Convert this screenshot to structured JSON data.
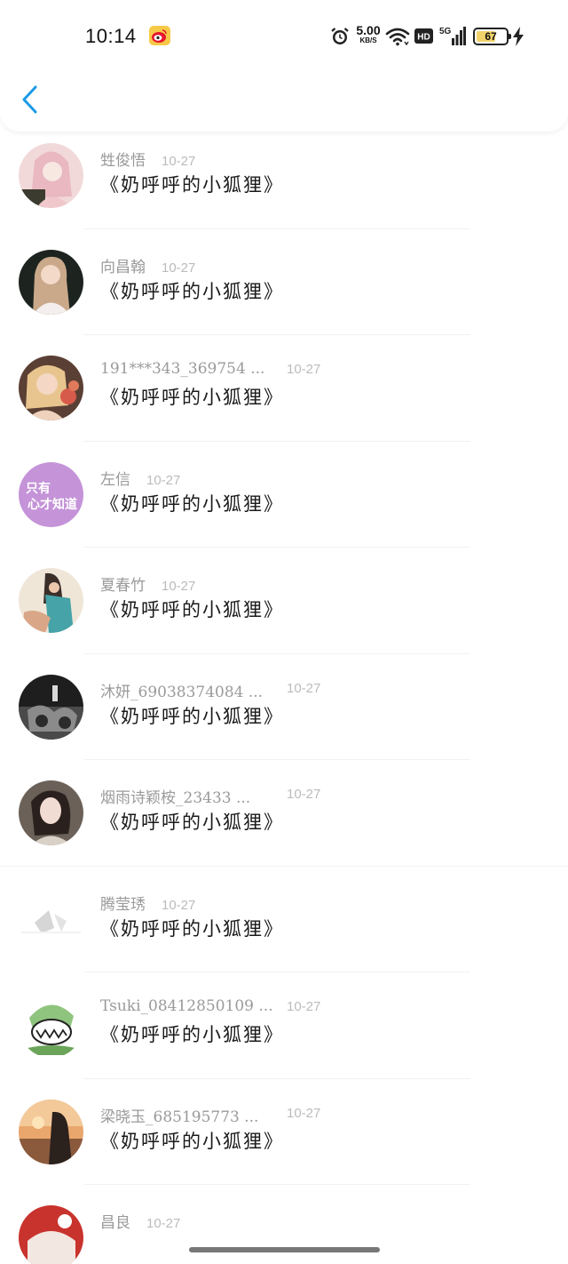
{
  "status_bar": {
    "time": "10:14",
    "net_speed_value": "5.00",
    "net_speed_unit": "KB/S",
    "hd_label": "HD",
    "signal_label": "5G",
    "battery_percent": "67",
    "icons": [
      "weibo-icon",
      "alarm-icon",
      "wifi-icon",
      "hd-icon",
      "signal-icon",
      "battery-icon",
      "charging-icon"
    ]
  },
  "nav": {
    "back_icon": "chevron-left-icon",
    "accent_color": "#1a9be6"
  },
  "items": [
    {
      "name": "甡俊悟",
      "date": "10-27",
      "content": "《奶呼呼的小狐狸》",
      "avatar": "photo-pink-girl"
    },
    {
      "name": "向昌翰",
      "date": "10-27",
      "content": "《奶呼呼的小狐狸》",
      "avatar": "photo-blonde-girl"
    },
    {
      "name": "191***343_369754 ...",
      "date": "10-27",
      "content": "《奶呼呼的小狐狸》",
      "avatar": "photo-flowers"
    },
    {
      "name": "左信",
      "date": "10-27",
      "content": "《奶呼呼的小狐狸》",
      "avatar_text": "只有\n心才知道",
      "avatar_color": "#c493d8"
    },
    {
      "name": "夏春竹",
      "date": "10-27",
      "content": "《奶呼呼的小狐狸》",
      "avatar": "photo-beach"
    },
    {
      "name": "沐妍_69038374084 ...",
      "date": "10-27",
      "content": "《奶呼呼的小狐狸》",
      "avatar": "photo-dark"
    },
    {
      "name": "烟雨诗颖桉_23433 ...",
      "date": "10-27",
      "content": "《奶呼呼的小狐狸》",
      "avatar": "photo-portrait"
    },
    {
      "name": "腾莹琇",
      "date": "10-27",
      "content": "《奶呼呼的小狐狸》",
      "avatar": "photo-blank"
    },
    {
      "name": "Tsuki_08412850109 ...",
      "date": "10-27",
      "content": "《奶呼呼的小狐狸》",
      "avatar": "cartoon-monster"
    },
    {
      "name": "梁晓玉_685195773 ...",
      "date": "10-27",
      "content": "《奶呼呼的小狐狸》",
      "avatar": "photo-sunset"
    },
    {
      "name": "昌良",
      "date": "10-27",
      "content": "",
      "avatar": "photo-red"
    }
  ]
}
